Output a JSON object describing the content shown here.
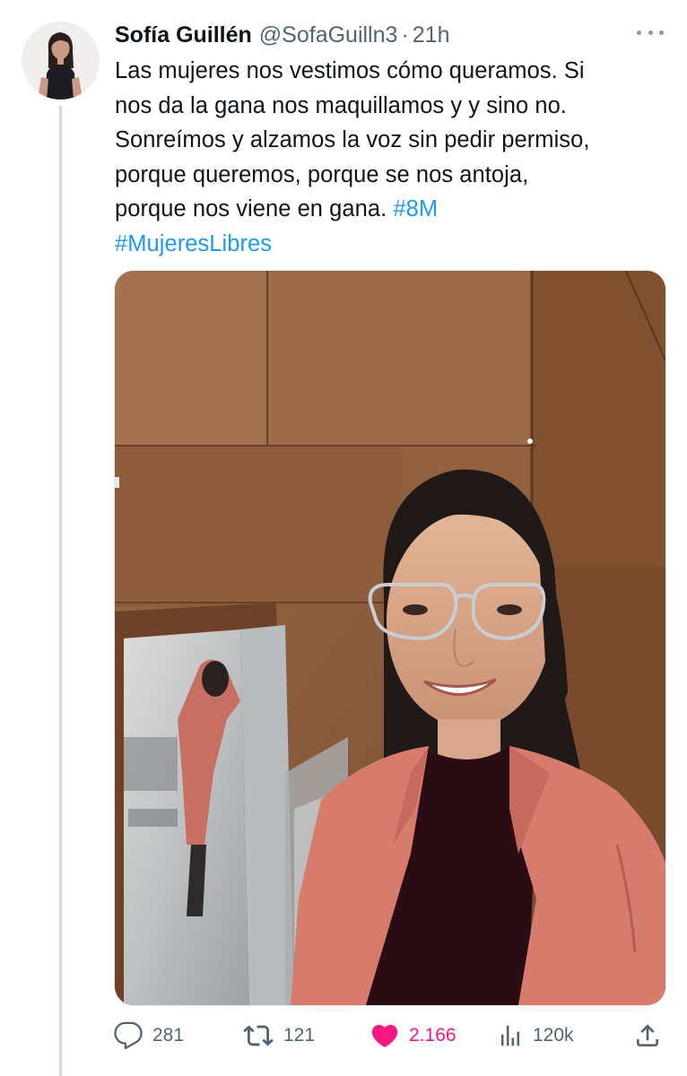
{
  "tweet": {
    "author_name": "Sofía Guillén",
    "handle": "@SofaGuilln3",
    "separator": "·",
    "time": "21h",
    "text_lines": [
      {
        "text": "Las mujeres nos vestimos cómo queramos. Si",
        "tag": ""
      },
      {
        "text": "nos da la gana nos maquillamos y y sino no.",
        "tag": ""
      },
      {
        "text": "Sonreímos y alzamos la voz sin pedir permiso,",
        "tag": ""
      },
      {
        "text": "porque queremos, porque se nos antoja,",
        "tag": ""
      },
      {
        "text": "porque nos viene en gana. ",
        "tag": "#8M"
      },
      {
        "text": "",
        "tag": "#MujeresLibres"
      }
    ]
  },
  "actions": {
    "replies": "281",
    "retweets": "121",
    "likes": "2.166",
    "views": "120k"
  },
  "icons": {
    "reply": "reply-icon",
    "retweet": "retweet-icon",
    "like": "heart-icon",
    "views": "views-icon",
    "share": "share-icon",
    "more": "more-icon"
  },
  "colors": {
    "link": "#1d9bf0",
    "like": "#f91880",
    "muted": "#536471",
    "text": "#0f1419"
  }
}
